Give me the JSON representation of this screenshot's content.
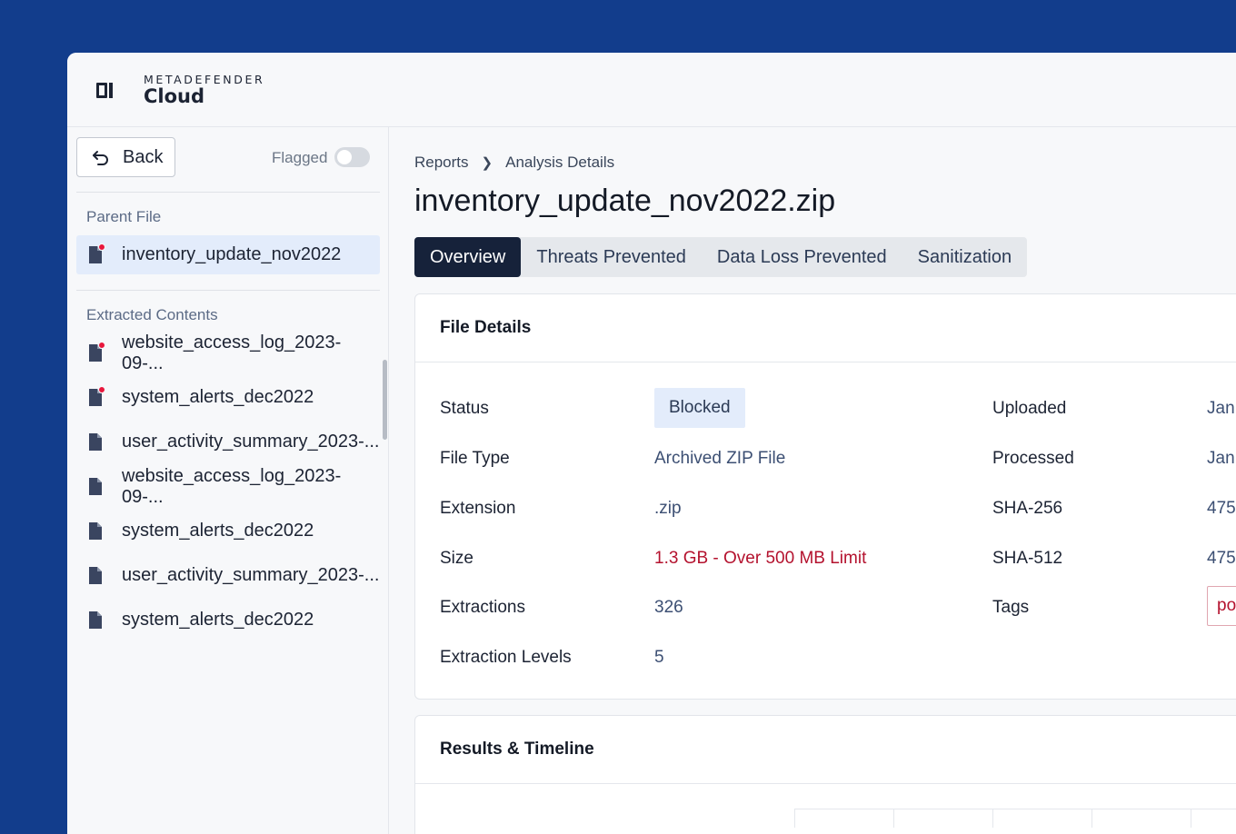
{
  "brand": {
    "top": "METADEFENDER",
    "bottom": "Cloud"
  },
  "sidebar": {
    "back_label": "Back",
    "flagged_label": "Flagged",
    "parent_label": "Parent File",
    "parent_file": {
      "name": "inventory_update_nov2022",
      "flagged": true
    },
    "extracted_label": "Extracted Contents",
    "items": [
      {
        "name": "website_access_log_2023-09-...",
        "flagged": true
      },
      {
        "name": "system_alerts_dec2022",
        "flagged": true
      },
      {
        "name": "user_activity_summary_2023-...",
        "flagged": false
      },
      {
        "name": "website_access_log_2023-09-...",
        "flagged": false
      },
      {
        "name": "system_alerts_dec2022",
        "flagged": false
      },
      {
        "name": "user_activity_summary_2023-...",
        "flagged": false
      },
      {
        "name": "system_alerts_dec2022",
        "flagged": false
      }
    ]
  },
  "breadcrumb": {
    "root": "Reports",
    "current": "Analysis Details"
  },
  "title": "inventory_update_nov2022.zip",
  "tabs": [
    "Overview",
    "Threats Prevented",
    "Data Loss Prevented",
    "Sanitization"
  ],
  "file_details": {
    "heading": "File Details",
    "status_label": "Status",
    "status_value": "Blocked",
    "type_label": "File Type",
    "type_value": "Archived ZIP File",
    "ext_label": "Extension",
    "ext_value": ".zip",
    "size_label": "Size",
    "size_value": "1.3 GB - Over 500 MB Limit",
    "extractions_label": "Extractions",
    "extractions_value": "326",
    "levels_label": "Extraction Levels",
    "levels_value": "5",
    "uploaded_label": "Uploaded",
    "uploaded_value": "Jan",
    "processed_label": "Processed",
    "processed_value": "Jan",
    "sha256_label": "SHA-256",
    "sha256_value": "475",
    "sha512_label": "SHA-512",
    "sha512_value": "475",
    "tags_label": "Tags",
    "tags_value": "po"
  },
  "results": {
    "heading": "Results & Timeline"
  },
  "colors": {
    "background": "#123d8c",
    "active_tab": "#16223a",
    "danger": "#b4122e",
    "flag_dot": "#e8173c"
  }
}
